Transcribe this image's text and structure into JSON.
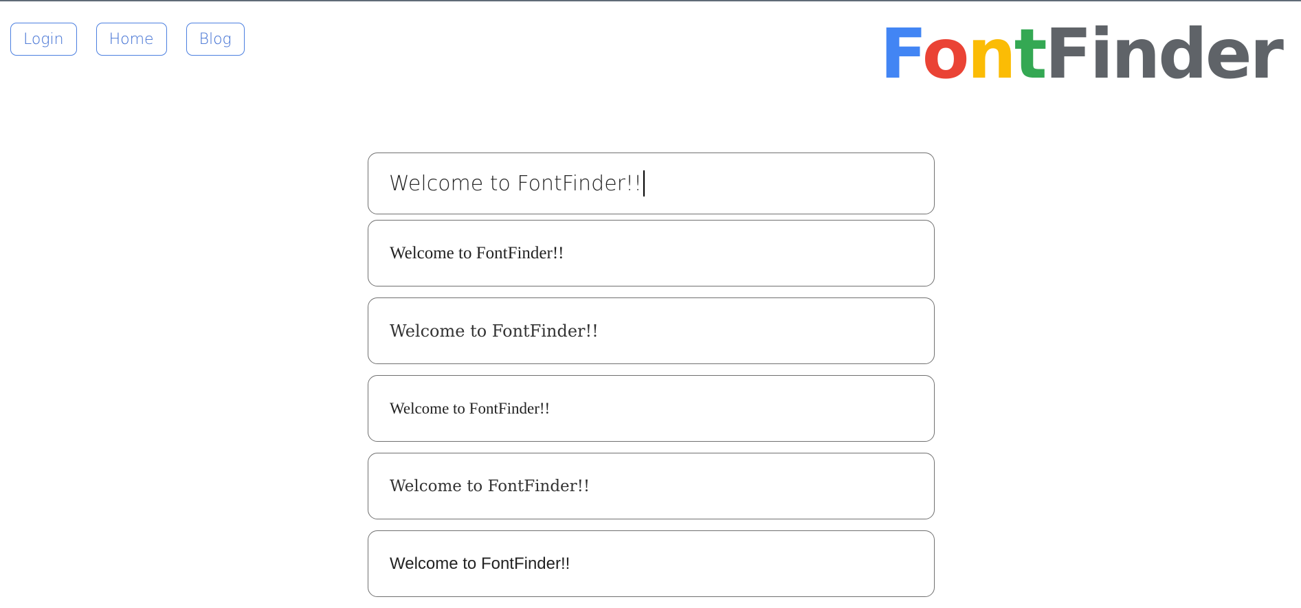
{
  "nav": {
    "items": [
      {
        "label": "Login"
      },
      {
        "label": "Home"
      },
      {
        "label": "Blog"
      }
    ]
  },
  "logo": {
    "letters": [
      {
        "char": "F",
        "color": "#4285f4"
      },
      {
        "char": "o",
        "color": "#ea4335"
      },
      {
        "char": "n",
        "color": "#fbbc05"
      },
      {
        "char": "t",
        "color": "#34a853"
      },
      {
        "char": "Finder",
        "color": "#5f6368"
      }
    ]
  },
  "search": {
    "value": "Welcome to FontFinder!!"
  },
  "previews": [
    {
      "text": "Welcome to FontFinder!!"
    },
    {
      "text": "Welcome to FontFinder!!"
    },
    {
      "text": "Welcome to FontFinder!!"
    },
    {
      "text": "Welcome to FontFinder!!"
    },
    {
      "text": "Welcome to FontFinder!!"
    }
  ]
}
